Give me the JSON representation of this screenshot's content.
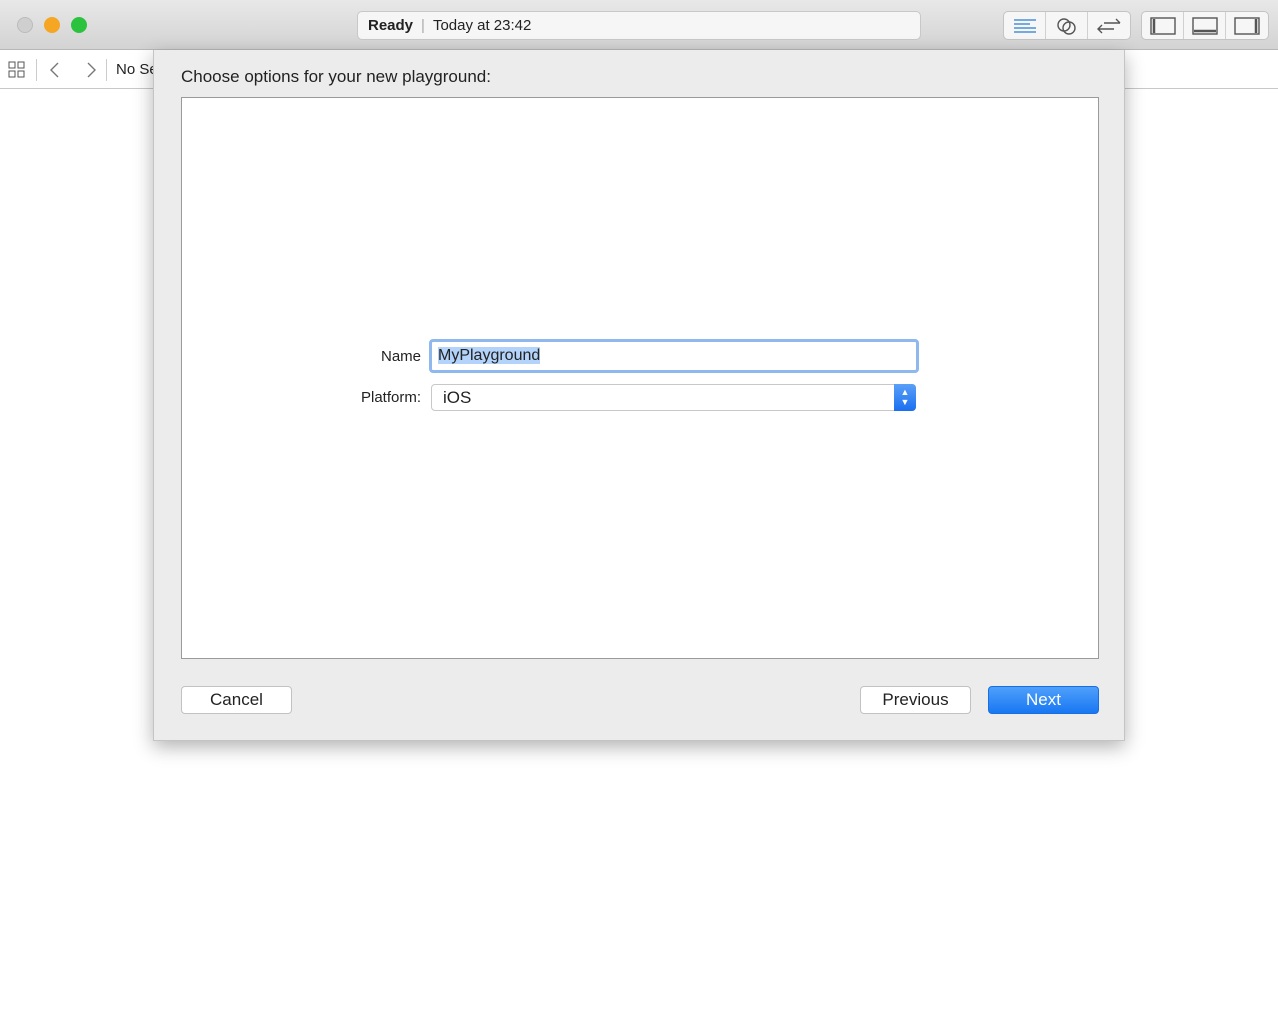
{
  "window": {
    "status": "Ready",
    "status_time": "Today at 23:42",
    "breadcrumb": "No Se"
  },
  "colors": {
    "close": "#cfcfcf",
    "minimize": "#f5a623",
    "zoom": "#2bc33e",
    "accent": "#1877f2"
  },
  "toolbar": {
    "icons": [
      "standard-editor-icon",
      "assistant-editor-icon",
      "version-editor-icon",
      "navigator-toggle-icon",
      "debug-area-toggle-icon",
      "utilities-toggle-icon"
    ]
  },
  "dialog": {
    "title": "Choose options for your new playground:",
    "name_label": "Name",
    "name_value": "MyPlayground",
    "platform_label": "Platform:",
    "platform_value": "iOS",
    "cancel": "Cancel",
    "previous": "Previous",
    "next": "Next"
  }
}
